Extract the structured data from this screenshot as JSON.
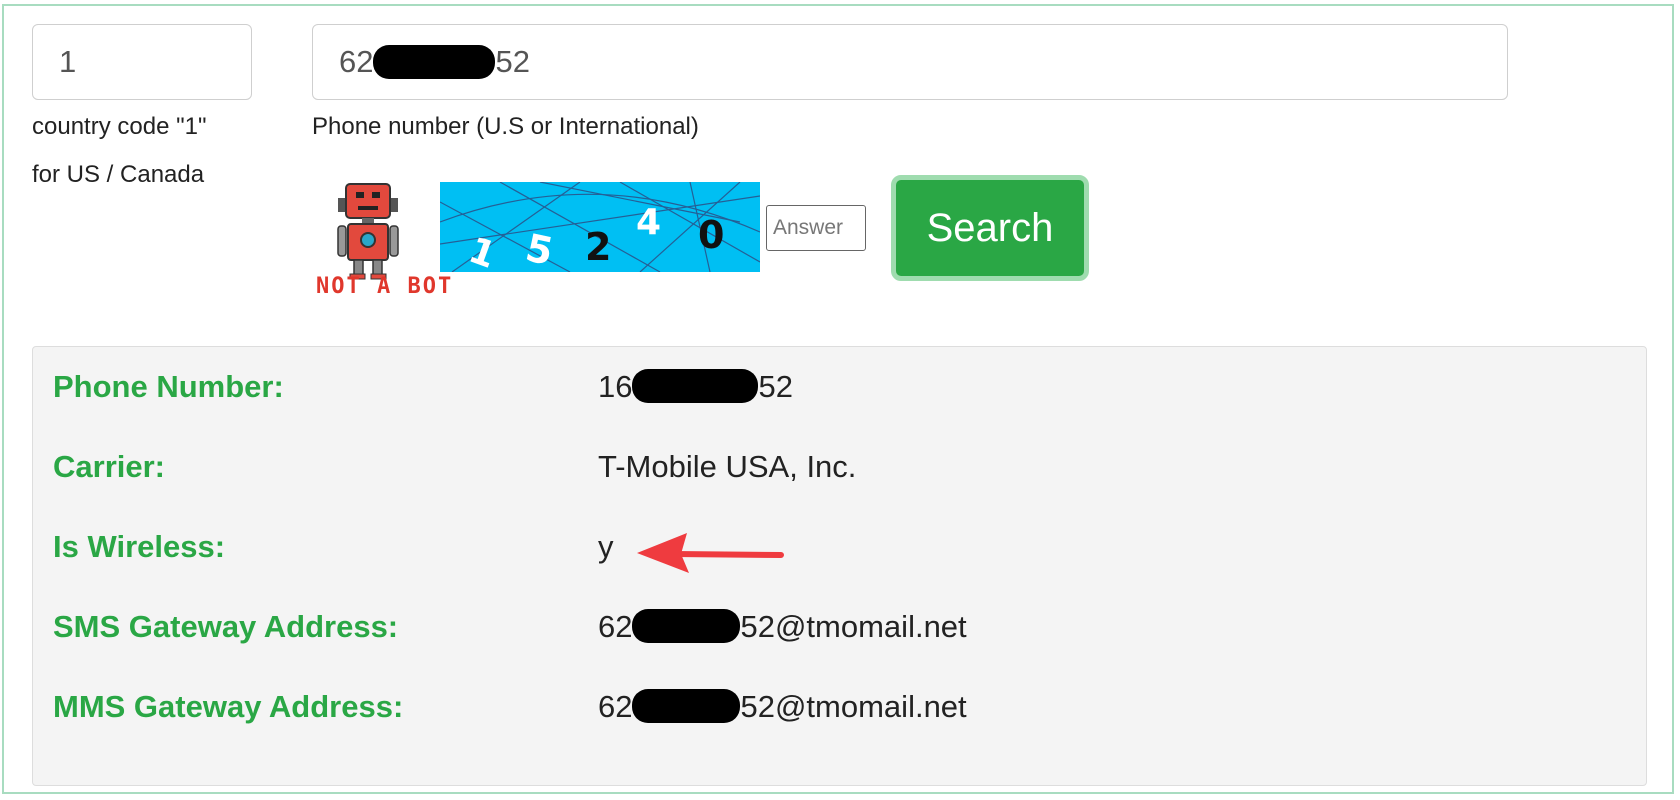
{
  "form": {
    "country_code_value": "1",
    "country_hint_line1": "country code \"1\"",
    "country_hint_line2": "for US / Canada",
    "phone_prefix": "62",
    "phone_suffix": "52",
    "phone_hint": "Phone number (U.S or International)",
    "bot_badge_text": "NOT A BOT",
    "captcha_digits": [
      "1",
      "5",
      "2",
      "4",
      "0"
    ],
    "answer_placeholder": "Answer",
    "search_label": "Search"
  },
  "results": {
    "rows": [
      {
        "label": "Phone Number:",
        "value_prefix": "16",
        "value_suffix": "52"
      },
      {
        "label": "Carrier:",
        "value": "T-Mobile USA, Inc."
      },
      {
        "label": "Is Wireless:",
        "value": "y"
      },
      {
        "label": "SMS Gateway Address:",
        "value_prefix": "62",
        "value_suffix": "52@tmomail.net"
      },
      {
        "label": "MMS Gateway Address:",
        "value_prefix": "62",
        "value_suffix": "52@tmomail.net"
      }
    ]
  },
  "colors": {
    "accent_green": "#2aa745",
    "frame_border": "#a8dcc0",
    "captcha_bg": "#00bff3",
    "arrow_red": "#ef3b3f",
    "badge_red": "#e0372c"
  },
  "icons": [
    "robot-icon",
    "red-arrow-annotation"
  ]
}
